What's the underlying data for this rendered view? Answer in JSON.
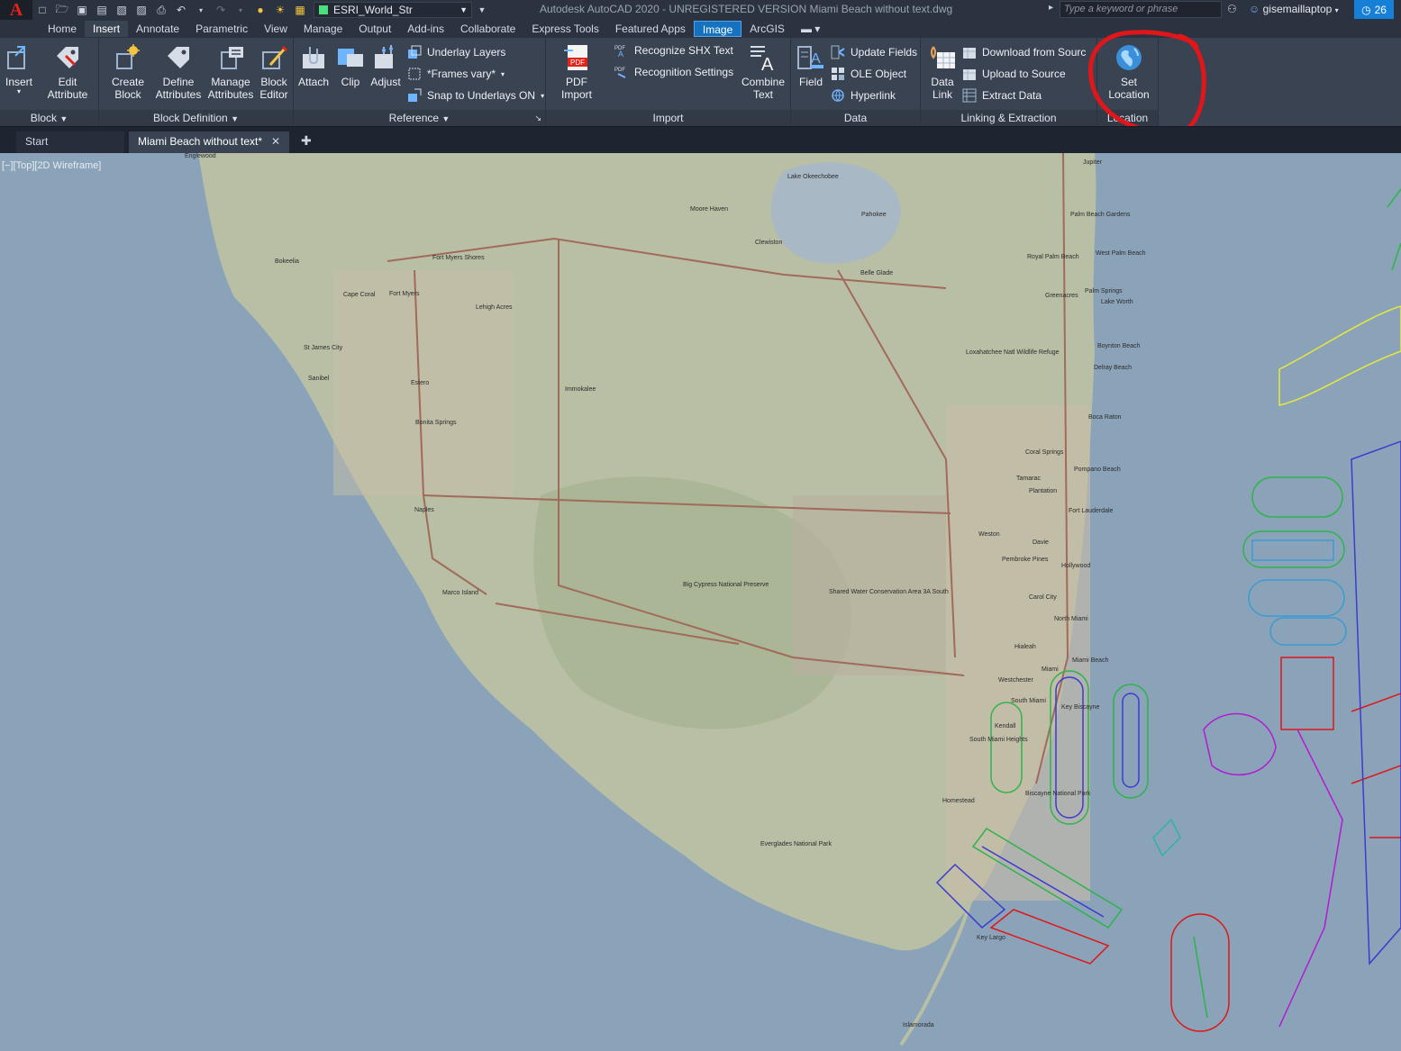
{
  "titlebar": {
    "app_letter": "A",
    "layer_name": "ESRI_World_Str",
    "window_title": "Autodesk AutoCAD 2020 - UNREGISTERED VERSION    Miami Beach without text.dwg",
    "search_placeholder": "Type a keyword or phrase",
    "user": "gisemaillaptop",
    "notification_count": "26",
    "layer_swatch_color": "#4ade80"
  },
  "ribbon_tabs": [
    "Home",
    "Insert",
    "Annotate",
    "Parametric",
    "View",
    "Manage",
    "Output",
    "Add-ins",
    "Collaborate",
    "Express Tools",
    "Featured Apps",
    "Image",
    "ArcGIS"
  ],
  "ribbon": {
    "block": {
      "title": "Block",
      "insert": "Insert",
      "edit_attribute_1": "Edit",
      "edit_attribute_2": "Attribute"
    },
    "block_definition": {
      "title": "Block Definition",
      "create_1": "Create",
      "create_2": "Block",
      "define_1": "Define",
      "define_2": "Attributes",
      "manage_1": "Manage",
      "manage_2": "Attributes",
      "editor_1": "Block",
      "editor_2": "Editor"
    },
    "reference": {
      "title": "Reference",
      "attach": "Attach",
      "clip": "Clip",
      "adjust": "Adjust",
      "underlay_layers": "Underlay Layers",
      "frames_vary": "*Frames vary*",
      "snap_underlays": "Snap to Underlays ON"
    },
    "import": {
      "title": "Import",
      "pdf_1": "PDF",
      "pdf_2": "Import",
      "recognize_shx": "Recognize SHX Text",
      "recognition_settings": "Recognition Settings",
      "combine_1": "Combine",
      "combine_2": "Text"
    },
    "data": {
      "title": "Data",
      "field": "Field",
      "update_fields": "Update Fields",
      "ole_object": "OLE Object",
      "hyperlink": "Hyperlink"
    },
    "linking": {
      "title": "Linking & Extraction",
      "data_link_1": "Data",
      "data_link_2": "Link",
      "download_source": "Download from Sourc",
      "upload_source": "Upload to Source",
      "extract_data": "Extract  Data"
    },
    "location": {
      "title": "Location",
      "set_location_1": "Set",
      "set_location_2": "Location"
    }
  },
  "doc_tabs": {
    "start": "Start",
    "active": "Miami Beach without text*"
  },
  "viewport": {
    "label": "[−][Top][2D Wireframe]"
  },
  "map_labels": [
    "Englewood",
    "Moore Haven",
    "Clewiston",
    "Pahokee",
    "Jupiter",
    "Palm Beach Gardens",
    "West Palm Beach",
    "Royal Palm Beach",
    "Belle Glade",
    "Bokeelia",
    "Fort Myers Shores",
    "Cape Coral",
    "Fort Myers",
    "Lehigh Acres",
    "Greenacres",
    "Palm Springs",
    "Lake Worth",
    "Boynton Beach",
    "Delray Beach",
    "St James City",
    "Sanibel",
    "Estero",
    "Immokalee",
    "Boca Raton",
    "Bonita Springs",
    "Coral Springs",
    "Pompano Beach",
    "Tamarac",
    "Fort Lauderdale",
    "Plantation",
    "Naples",
    "Weston",
    "Davie",
    "Pembroke Pines",
    "Hollywood",
    "Marco Island",
    "Carol City",
    "North Miami",
    "Hialeah",
    "Miami Beach",
    "Miami",
    "Westchester",
    "South Miami",
    "Key Biscayne",
    "Kendall",
    "South Miami Heights",
    "Homestead",
    "Everglades National Park",
    "Key Largo",
    "Islamorada",
    "Big Cypress National Preserve",
    "Shared Water Conservation Area 3A South",
    "Loxahatchee Natl Wildlife Refuge",
    "Lake Okeechobee",
    "Biscayne National Park"
  ]
}
